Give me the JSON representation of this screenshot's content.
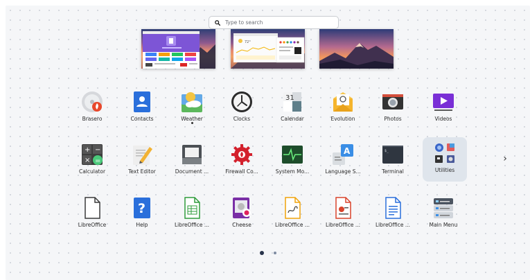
{
  "search": {
    "placeholder": "Type to search"
  },
  "workspaces": [
    {
      "name": "workspace-1"
    },
    {
      "name": "workspace-2"
    },
    {
      "name": "workspace-3"
    }
  ],
  "workspace2_temp": "72°",
  "apps": {
    "row1": [
      "Brasero",
      "Contacts",
      "Weather",
      "Clocks",
      "Calendar",
      "Evolution",
      "Photos",
      "Videos"
    ],
    "row2": [
      "Calculator",
      "Text Editor",
      "Document ...",
      "Firewall Co...",
      "System Mo...",
      "Language S...",
      "Terminal",
      "Utilities"
    ],
    "row3": [
      "LibreOffice",
      "Help",
      "LibreOffice ...",
      "Cheese",
      "LibreOffice ...",
      "LibreOffice ...",
      "LibreOffice ...",
      "Main Menu"
    ]
  },
  "calendar_day": "31",
  "language_letter": "A",
  "next_page": "›",
  "pages": {
    "current": 1,
    "total": 2
  }
}
